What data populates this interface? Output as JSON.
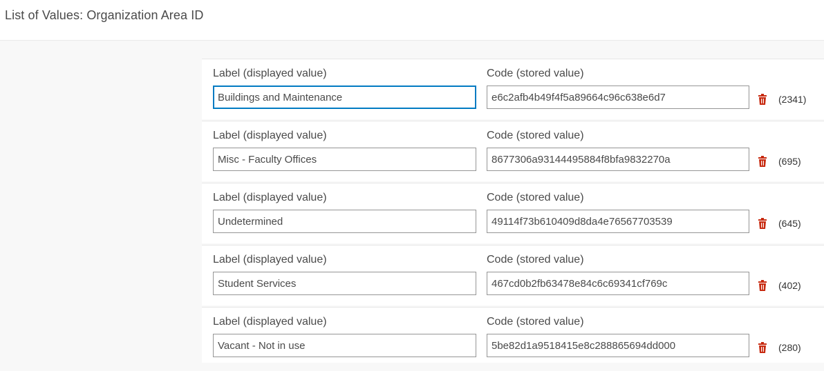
{
  "header": {
    "title": "List of Values: Organization Area ID"
  },
  "colors": {
    "accent": "#007ac2",
    "danger": "#c7290f",
    "border": "#959595"
  },
  "rows": [
    {
      "label_heading": "Label (displayed value)",
      "code_heading": "Code (stored value)",
      "label": "Buildings and Maintenance",
      "code": "e6c2afb4b49f4f5a89664c96c638e6d7",
      "count": "(2341)",
      "delete_icon": "trash-icon"
    },
    {
      "label_heading": "Label (displayed value)",
      "code_heading": "Code (stored value)",
      "label": "Misc - Faculty Offices",
      "code": "8677306a93144495884f8bfa9832270a",
      "count": "(695)",
      "delete_icon": "trash-icon"
    },
    {
      "label_heading": "Label (displayed value)",
      "code_heading": "Code (stored value)",
      "label": "Undetermined",
      "code": "49114f73b610409d8da4e76567703539",
      "count": "(645)",
      "delete_icon": "trash-icon"
    },
    {
      "label_heading": "Label (displayed value)",
      "code_heading": "Code (stored value)",
      "label": "Student Services",
      "code": "467cd0b2fb63478e84c6c69341cf769c",
      "count": "(402)",
      "delete_icon": "trash-icon"
    },
    {
      "label_heading": "Label (displayed value)",
      "code_heading": "Code (stored value)",
      "label": "Vacant - Not in use",
      "code": "5be82d1a9518415e8c288865694dd000",
      "count": "(280)",
      "delete_icon": "trash-icon"
    }
  ]
}
